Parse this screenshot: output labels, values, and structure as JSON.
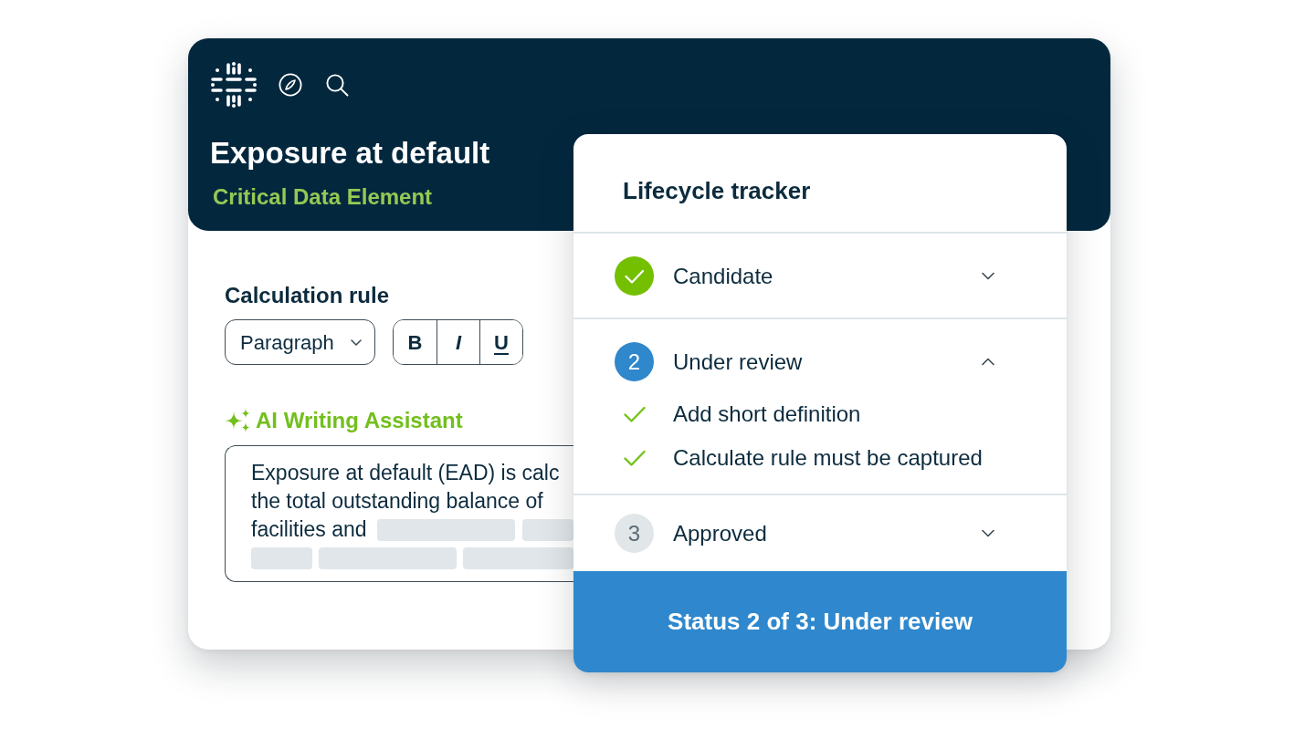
{
  "header": {
    "title": "Exposure at default",
    "subtitle": "Critical Data Element"
  },
  "editor": {
    "label": "Calculation rule",
    "block_style": "Paragraph",
    "format_buttons": [
      {
        "kind": "bold",
        "label": "B"
      },
      {
        "kind": "italic",
        "label": "I"
      },
      {
        "kind": "underline",
        "label": "U"
      }
    ],
    "assistant": "AI Writing Assistant",
    "text_lines": [
      "Exposure at default (EAD) is calc",
      "the total outstanding balance of",
      "facilities and"
    ]
  },
  "tracker": {
    "title": "Lifecycle tracker",
    "stages": [
      {
        "label": "Candidate",
        "done": true,
        "current": false,
        "expanded": false
      },
      {
        "number": "2",
        "label": "Under review",
        "done": false,
        "current": true,
        "expanded": true,
        "tasks": [
          {
            "label": "Add short definition",
            "checked": true
          },
          {
            "label": "Calculate rule must be captured",
            "checked": true
          }
        ]
      },
      {
        "number": "3",
        "label": "Approved",
        "done": false,
        "current": false,
        "expanded": false
      }
    ],
    "footer": "Status 2 of 3: Under review"
  }
}
